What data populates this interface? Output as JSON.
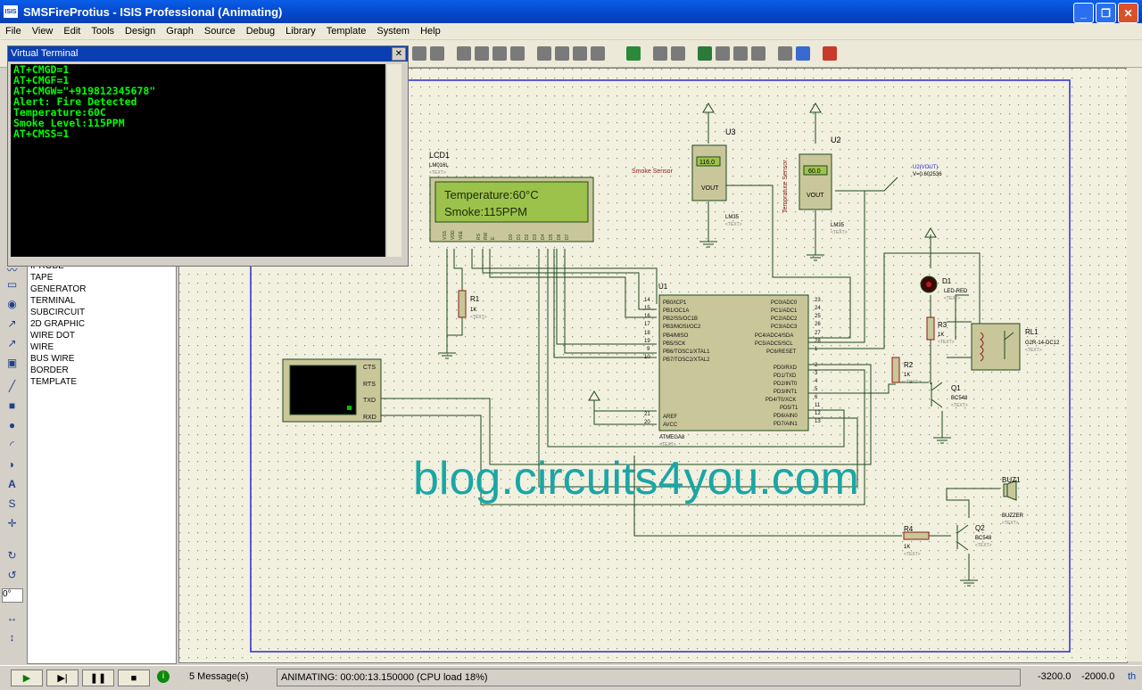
{
  "window": {
    "title": "SMSFireProtius - ISIS Professional (Animating)",
    "app_icon": "ISIS"
  },
  "menu": [
    "File",
    "View",
    "Edit",
    "Tools",
    "Design",
    "Graph",
    "Source",
    "Debug",
    "Library",
    "Template",
    "System",
    "Help"
  ],
  "virtual_terminal": {
    "title": "Virtual Terminal",
    "lines": [
      "AT+CMGD=1",
      "AT+CMGF=1",
      "AT+CMGW=\"+919812345678\"",
      "Alert: Fire Detected",
      "Temperature:60C",
      "Smoke Level:115PPM",
      "AT+CMSS=1"
    ]
  },
  "mode_list": [
    "IPROBE",
    "TAPE",
    "GENERATOR",
    "TERMINAL",
    "SUBCIRCUIT",
    "2D GRAPHIC",
    "WIRE DOT",
    "WIRE",
    "BUS WIRE",
    "BORDER",
    "TEMPLATE"
  ],
  "rotation_value": "0°",
  "schematic": {
    "watermark": "blog.circuits4you.com",
    "lcd": {
      "ref": "LCD1",
      "part": "LM016L",
      "text_tag": "<TEXT>",
      "line1": "Temperature:60°C",
      "line2": "Smoke:115PPM",
      "pins": [
        "VSS",
        "VDD",
        "VEE",
        "RS",
        "RW",
        "E",
        "D0",
        "D1",
        "D2",
        "D3",
        "D4",
        "D5",
        "D6",
        "D7"
      ]
    },
    "u3": {
      "ref": "U3",
      "label": "Smoke Sensor",
      "display": "116.0",
      "pin": "VOUT",
      "part": "LM35",
      "text_tag": "<TEXT>"
    },
    "u2": {
      "ref": "U2",
      "label": "Temprature Sensor",
      "display": "60.0",
      "pin": "VOUT",
      "part": "LM35",
      "text_tag": "<TEXT>"
    },
    "probe": {
      "name": "U2(VOUT)",
      "value": "V=0.602536"
    },
    "u1": {
      "ref": "U1",
      "part": "ATMEGA8",
      "text_tag": "<TEXT>",
      "left_pins": [
        "PB0/ICP1",
        "PB1/OC1A",
        "PB2/SS/OC1B",
        "PB3/MOSI/OC2",
        "PB4/MISO",
        "PB5/SCK",
        "PB6/TOSC1/XTAL1",
        "PB7/TOSC2/XTAL2"
      ],
      "left_nums": [
        "14",
        "15",
        "16",
        "17",
        "18",
        "19",
        "9",
        "10"
      ],
      "right_pins": [
        "PC0/ADC0",
        "PC1/ADC1",
        "PC2/ADC2",
        "PC3/ADC3",
        "PC4/ADC4/SDA",
        "PC5/ADC5/SCL",
        "PC6/RESET"
      ],
      "right_nums": [
        "23",
        "24",
        "25",
        "26",
        "27",
        "28",
        "1"
      ],
      "pd_pins": [
        "PD0/RXD",
        "PD1/TXD",
        "PD2/INT0",
        "PD3/INT1",
        "PD4/T0/XCK",
        "PD5/T1",
        "PD6/AIN0",
        "PD7/AIN1"
      ],
      "pd_nums": [
        "2",
        "3",
        "4",
        "5",
        "6",
        "11",
        "12",
        "13"
      ],
      "aref": "AREF",
      "avcc": "AVCC",
      "aref_num": "21",
      "avcc_num": "20"
    },
    "r1": {
      "ref": "R1",
      "value": "1K",
      "text_tag": "<TEXT>"
    },
    "r2": {
      "ref": "R2",
      "value": "1K",
      "text_tag": "<TEXT>"
    },
    "r3": {
      "ref": "R3",
      "value": "1K",
      "text_tag": "<TEXT>"
    },
    "r4": {
      "ref": "R4",
      "value": "1K",
      "text_tag": "<TEXT>"
    },
    "d1": {
      "ref": "D1",
      "part": "LED-RED",
      "text_tag": "<TEXT>"
    },
    "rl1": {
      "ref": "RL1",
      "part": "G2R-14-DC12",
      "text_tag": "<TEXT>"
    },
    "q1": {
      "ref": "Q1",
      "part": "BC548",
      "text_tag": "<TEXT>"
    },
    "q2": {
      "ref": "Q2",
      "part": "BC548",
      "text_tag": "<TEXT>"
    },
    "buz1": {
      "ref": "BUZ1",
      "part": "BUZZER",
      "text_tag": "<TEXT>"
    },
    "serial": {
      "pins": [
        "CTS",
        "RTS",
        "TXD",
        "RXD"
      ]
    }
  },
  "status": {
    "messages": "5 Message(s)",
    "animating": "ANIMATING: 00:00:13.150000 (CPU load 18%)",
    "coord_x": "-3200.0",
    "coord_y": "-2000.0",
    "units": "th"
  }
}
